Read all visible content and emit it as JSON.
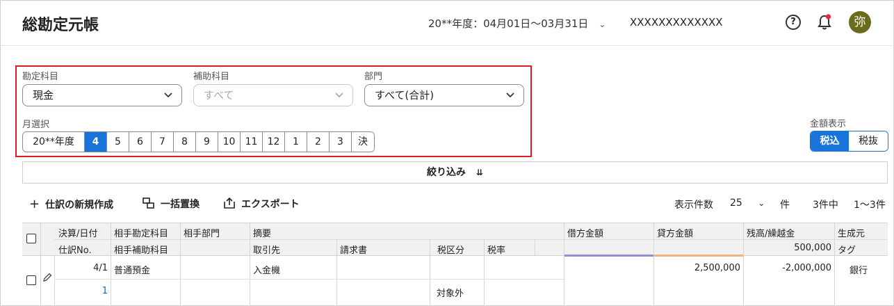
{
  "header": {
    "title": "総勘定元帳",
    "period": "20**年度：04月01日～03月31日",
    "company": "XXXXXXXXXXXXX",
    "avatar_text": "弥"
  },
  "filters": {
    "account_label": "勘定科目",
    "account_value": "現金",
    "subaccount_label": "補助科目",
    "subaccount_value": "すべて",
    "department_label": "部門",
    "department_value": "すべて(合計)",
    "month_label": "月選択",
    "months": [
      "20**年度",
      "4",
      "5",
      "6",
      "7",
      "8",
      "9",
      "10",
      "11",
      "12",
      "1",
      "2",
      "3",
      "決"
    ],
    "active_month": "4"
  },
  "amount_display": {
    "label": "金額表示",
    "options": [
      "税込",
      "税抜"
    ],
    "selected": "税込"
  },
  "narrow": {
    "label": "絞り込み"
  },
  "toolbar": {
    "new_entry": "仕訳の新規作成",
    "bulk_replace": "一括置換",
    "export": "エクスポート",
    "per_page_label": "表示件数",
    "per_page_value": "25",
    "per_page_unit": "件",
    "count_text": "3件中",
    "range_text": "1～3件"
  },
  "table": {
    "headers_row1": {
      "date": "決算/日付",
      "counter_account": "相手勘定科目",
      "counter_department": "相手部門",
      "summary": "摘要",
      "debit": "借方金額",
      "credit": "貸方金額",
      "balance": "残高/繰越金",
      "source": "生成元"
    },
    "headers_row2": {
      "journal_no": "仕訳No.",
      "counter_subaccount": "相手補助科目",
      "partner": "取引先",
      "invoice": "請求書",
      "tax_class": "税区分",
      "tax_rate": "税率",
      "carry_over": "500,000",
      "tag": "タグ"
    },
    "rows": [
      {
        "date": "4/1",
        "journal_no": "1",
        "counter_account": "普通預金",
        "summary": "入金機",
        "debit": "",
        "credit": "2,500,000",
        "balance": "-2,000,000",
        "source": "銀行",
        "tax_class": "対象外"
      }
    ]
  },
  "colors": {
    "accent": "#1a73d9",
    "highlight_border": "#d91e26",
    "debit_underline": "#8f8fd6",
    "credit_underline": "#f0b27a",
    "avatar_bg": "#6b6b1c"
  }
}
